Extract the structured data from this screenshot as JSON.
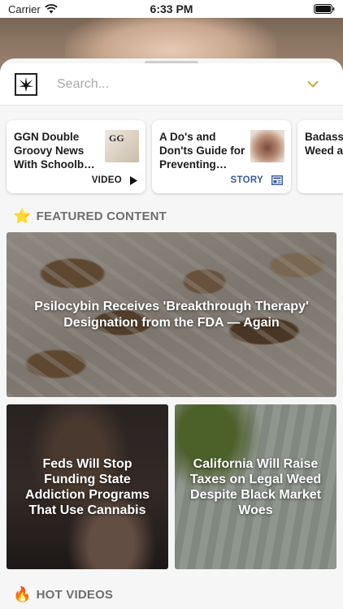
{
  "status_bar": {
    "carrier": "Carrier",
    "time": "6:33 PM"
  },
  "search": {
    "placeholder": "Search..."
  },
  "cards": [
    {
      "title": "GGN Double Groovy News With Schoolb…",
      "type": "VIDEO",
      "type_icon": "play-icon"
    },
    {
      "title": "A Do's and Don'ts Guide for Preventing…",
      "type": "STORY",
      "type_icon": "newspaper-icon"
    },
    {
      "title": "Badass Who Sm Weed a",
      "type": "",
      "type_icon": ""
    }
  ],
  "featured": {
    "heading": "FEATURED CONTENT",
    "icon": "star-icon",
    "main": {
      "title": "Psilocybin Receives 'Breakthrough Therapy' Designation from the FDA — Again"
    },
    "tiles": [
      {
        "title": "Feds Will Stop Funding State Addiction Programs That Use Cannabis"
      },
      {
        "title": "California Will Raise Taxes on Legal Weed Despite Black Market Woes"
      }
    ]
  },
  "hot_videos": {
    "heading": "HOT VIDEOS",
    "icon": "fire-icon"
  },
  "colors": {
    "accent_gold": "#c9a93a",
    "story_blue": "#3b5b9a",
    "sheet_bg": "#f6f6f6"
  }
}
